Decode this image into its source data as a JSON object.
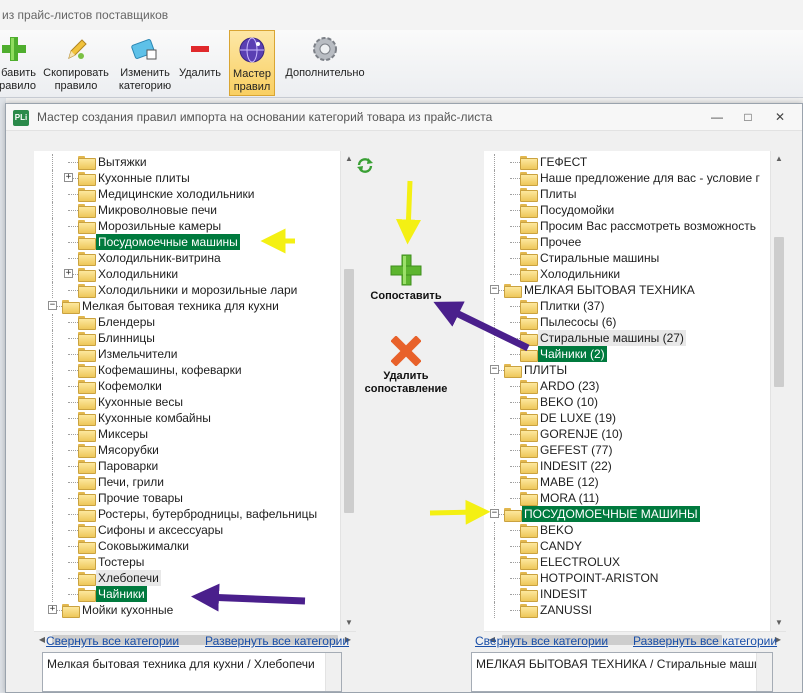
{
  "background_app": {
    "title": "из прайс-листов поставщиков",
    "ribbon": [
      {
        "name": "add",
        "label": "бавить\nравило",
        "icon": "plus-icon"
      },
      {
        "name": "copy",
        "label": "Скопировать\nправило",
        "icon": "pencil-icon"
      },
      {
        "name": "edit",
        "label": "Изменить\nкатегорию",
        "icon": "tag-edit-icon"
      },
      {
        "name": "delete",
        "label": "Удалить",
        "icon": "minus-icon"
      },
      {
        "name": "wizard",
        "label": "Мастер\nправил",
        "icon": "wizard-globe-icon",
        "active": true
      },
      {
        "name": "more",
        "label": "Дополнительно",
        "icon": "gear-icon"
      }
    ]
  },
  "dialog": {
    "icon_text": "PLi",
    "title": "Мастер создания правил импорта на основании категорий товара из прайс-листа",
    "minimize": "—",
    "maximize": "□",
    "close": "✕"
  },
  "left_tree": {
    "rows": [
      {
        "label": "Вытяжки",
        "level": 2,
        "expander": null,
        "state": ""
      },
      {
        "label": "Кухонные плиты",
        "level": 2,
        "expander": "+",
        "state": ""
      },
      {
        "label": "Медицинские холодильники",
        "level": 2,
        "expander": null,
        "state": ""
      },
      {
        "label": "Микроволновые печи",
        "level": 2,
        "expander": null,
        "state": ""
      },
      {
        "label": "Морозильные камеры",
        "level": 2,
        "expander": null,
        "state": ""
      },
      {
        "label": "Посудомоечные машины",
        "level": 2,
        "expander": null,
        "state": "selected"
      },
      {
        "label": "Холодильник-витрина",
        "level": 2,
        "expander": null,
        "state": ""
      },
      {
        "label": "Холодильники",
        "level": 2,
        "expander": "+",
        "state": ""
      },
      {
        "label": "Холодильники и морозильные лари",
        "level": 2,
        "expander": null,
        "state": ""
      },
      {
        "label": "Мелкая бытовая техника для кухни",
        "level": 1,
        "expander": "−",
        "state": ""
      },
      {
        "label": "Блендеры",
        "level": 2,
        "expander": null,
        "state": ""
      },
      {
        "label": "Блинницы",
        "level": 2,
        "expander": null,
        "state": ""
      },
      {
        "label": "Измельчители",
        "level": 2,
        "expander": null,
        "state": ""
      },
      {
        "label": "Кофемашины, кофеварки",
        "level": 2,
        "expander": null,
        "state": ""
      },
      {
        "label": "Кофемолки",
        "level": 2,
        "expander": null,
        "state": ""
      },
      {
        "label": "Кухонные весы",
        "level": 2,
        "expander": null,
        "state": ""
      },
      {
        "label": "Кухонные комбайны",
        "level": 2,
        "expander": null,
        "state": ""
      },
      {
        "label": "Миксеры",
        "level": 2,
        "expander": null,
        "state": ""
      },
      {
        "label": "Мясорубки",
        "level": 2,
        "expander": null,
        "state": ""
      },
      {
        "label": "Пароварки",
        "level": 2,
        "expander": null,
        "state": ""
      },
      {
        "label": "Печи, грили",
        "level": 2,
        "expander": null,
        "state": ""
      },
      {
        "label": "Прочие товары",
        "level": 2,
        "expander": null,
        "state": ""
      },
      {
        "label": "Ростеры, бутербродницы, вафельницы",
        "level": 2,
        "expander": null,
        "state": ""
      },
      {
        "label": "Сифоны и аксессуары",
        "level": 2,
        "expander": null,
        "state": ""
      },
      {
        "label": "Соковыжималки",
        "level": 2,
        "expander": null,
        "state": ""
      },
      {
        "label": "Тостеры",
        "level": 2,
        "expander": null,
        "state": ""
      },
      {
        "label": "Хлебопечи",
        "level": 2,
        "expander": null,
        "state": "hover"
      },
      {
        "label": "Чайники",
        "level": 2,
        "expander": null,
        "state": "selected"
      },
      {
        "label": "Мойки кухонные",
        "level": 1,
        "expander": "+",
        "state": ""
      }
    ],
    "collapse_all": "Свернуть все категории",
    "expand_all": "Развернуть все категории",
    "path": "Мелкая бытовая техника для кухни / Хлебопечи"
  },
  "right_tree": {
    "rows": [
      {
        "label": "ГЕФЕСТ",
        "level": 2,
        "expander": null,
        "state": ""
      },
      {
        "label": "Наше предложение для вас - условие г",
        "level": 2,
        "expander": null,
        "state": ""
      },
      {
        "label": "Плиты",
        "level": 2,
        "expander": null,
        "state": ""
      },
      {
        "label": "Посудомойки",
        "level": 2,
        "expander": null,
        "state": ""
      },
      {
        "label": "Просим Вас рассмотреть возможность",
        "level": 2,
        "expander": null,
        "state": ""
      },
      {
        "label": "Прочее",
        "level": 2,
        "expander": null,
        "state": ""
      },
      {
        "label": "Стиральные машины",
        "level": 2,
        "expander": null,
        "state": ""
      },
      {
        "label": "Холодильники",
        "level": 2,
        "expander": null,
        "state": ""
      },
      {
        "label": "МЕЛКАЯ БЫТОВАЯ ТЕХНИКА",
        "level": 1,
        "expander": "−",
        "state": ""
      },
      {
        "label": "Плитки (37)",
        "level": 2,
        "expander": null,
        "state": ""
      },
      {
        "label": "Пылесосы (6)",
        "level": 2,
        "expander": null,
        "state": ""
      },
      {
        "label": "Стиральные машины (27)",
        "level": 2,
        "expander": null,
        "state": "hover"
      },
      {
        "label": "Чайники (2)",
        "level": 2,
        "expander": null,
        "state": "selected"
      },
      {
        "label": "ПЛИТЫ",
        "level": 1,
        "expander": "−",
        "state": ""
      },
      {
        "label": "ARDO (23)",
        "level": 2,
        "expander": null,
        "state": ""
      },
      {
        "label": "BEKO (10)",
        "level": 2,
        "expander": null,
        "state": ""
      },
      {
        "label": "DE LUXE (19)",
        "level": 2,
        "expander": null,
        "state": ""
      },
      {
        "label": "GORENJE (10)",
        "level": 2,
        "expander": null,
        "state": ""
      },
      {
        "label": "GEFEST (77)",
        "level": 2,
        "expander": null,
        "state": ""
      },
      {
        "label": "INDESIT (22)",
        "level": 2,
        "expander": null,
        "state": ""
      },
      {
        "label": "MABE (12)",
        "level": 2,
        "expander": null,
        "state": ""
      },
      {
        "label": "MORA (11)",
        "level": 2,
        "expander": null,
        "state": ""
      },
      {
        "label": "ПОСУДОМОЕЧНЫЕ МАШИНЫ",
        "level": 1,
        "expander": "−",
        "state": "selected"
      },
      {
        "label": "BEKO",
        "level": 2,
        "expander": null,
        "state": ""
      },
      {
        "label": "CANDY",
        "level": 2,
        "expander": null,
        "state": ""
      },
      {
        "label": "ELECTROLUX",
        "level": 2,
        "expander": null,
        "state": ""
      },
      {
        "label": "HOTPOINT-ARISTON",
        "level": 2,
        "expander": null,
        "state": ""
      },
      {
        "label": "INDESIT",
        "level": 2,
        "expander": null,
        "state": ""
      },
      {
        "label": "ZANUSSI",
        "level": 2,
        "expander": null,
        "state": ""
      }
    ],
    "collapse_all": "Свернуть все категории",
    "expand_all": "Развернуть все категории",
    "path": "МЕЛКАЯ БЫТОВАЯ ТЕХНИКА / Стиральные машинки"
  },
  "middle": {
    "refresh_icon": "refresh-icon",
    "match_label": "Сопоставить",
    "unmatch_label": "Удалить\nсопоставление"
  },
  "colors": {
    "selection": "#007a3e",
    "arrow_yellow": "#f4f013",
    "arrow_purple": "#4a1f8c"
  }
}
